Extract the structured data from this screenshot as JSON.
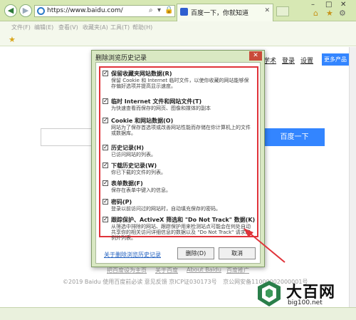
{
  "browser": {
    "url": "https://www.baidu.com/",
    "tab_title": "百度一下，你就知道",
    "menu": [
      "文件(F)",
      "编辑(E)",
      "查看(V)",
      "收藏夹(A)",
      "工具(T)",
      "帮助(H)"
    ]
  },
  "page": {
    "nav_links": [
      "学术",
      "登录",
      "设置"
    ],
    "more_products": "更多产品",
    "search_button": "百度一下",
    "footer_links": [
      "把百度设为主页",
      "关于百度",
      "About Baidu",
      "百度推广"
    ],
    "copyright": "©2019 Baidu 使用百度前必读 意见反馈 京ICP证030173号",
    "police": "京公网安备11000002000001号"
  },
  "dialog": {
    "title": "删除浏览历史记录",
    "options": [
      {
        "title": "保留收藏夹网站数据(R)",
        "desc": "保留 Cookie 和 Internet 临时文件，以使你收藏的网站能够保存偏好选项并提高显示速度。",
        "checked": true
      },
      {
        "title": "临时 Internet 文件和网站文件(T)",
        "desc": "为快速查看而保存的网页、图像和媒体的副本",
        "checked": true
      },
      {
        "title": "Cookie 和网站数据(O)",
        "desc": "网站为了保存首选项或改善网站性能而存储在你计算机上的文件或数据库。",
        "checked": true
      },
      {
        "title": "历史记录(H)",
        "desc": "已访问网站的列表。",
        "checked": true
      },
      {
        "title": "下载历史记录(W)",
        "desc": "你已下载的文件的列表。",
        "checked": true
      },
      {
        "title": "表单数据(F)",
        "desc": "保存在表单中键入的信息。",
        "checked": true
      },
      {
        "title": "密码(P)",
        "desc": "登录以前访问过的网站时，自动填充保存的密码。",
        "checked": true
      },
      {
        "title": "跟踪保护、ActiveX 筛选和 \"Do Not Track\" 数据(K)",
        "desc": "从筛选中排除的网站、跟踪保护用来检测站点可能会在何处自动共享你的相关访问详细信息的数据以及 \"Do Not Track\" 请求的例外列表。",
        "checked": true
      }
    ],
    "help_link": "关于删除浏览历史记录",
    "delete_button": "删除(D)",
    "cancel_button": "取消"
  },
  "watermark": {
    "name": "大百网",
    "url": "big100.net"
  },
  "colors": {
    "accent": "#3385ff",
    "highlight": "#e0333a"
  }
}
